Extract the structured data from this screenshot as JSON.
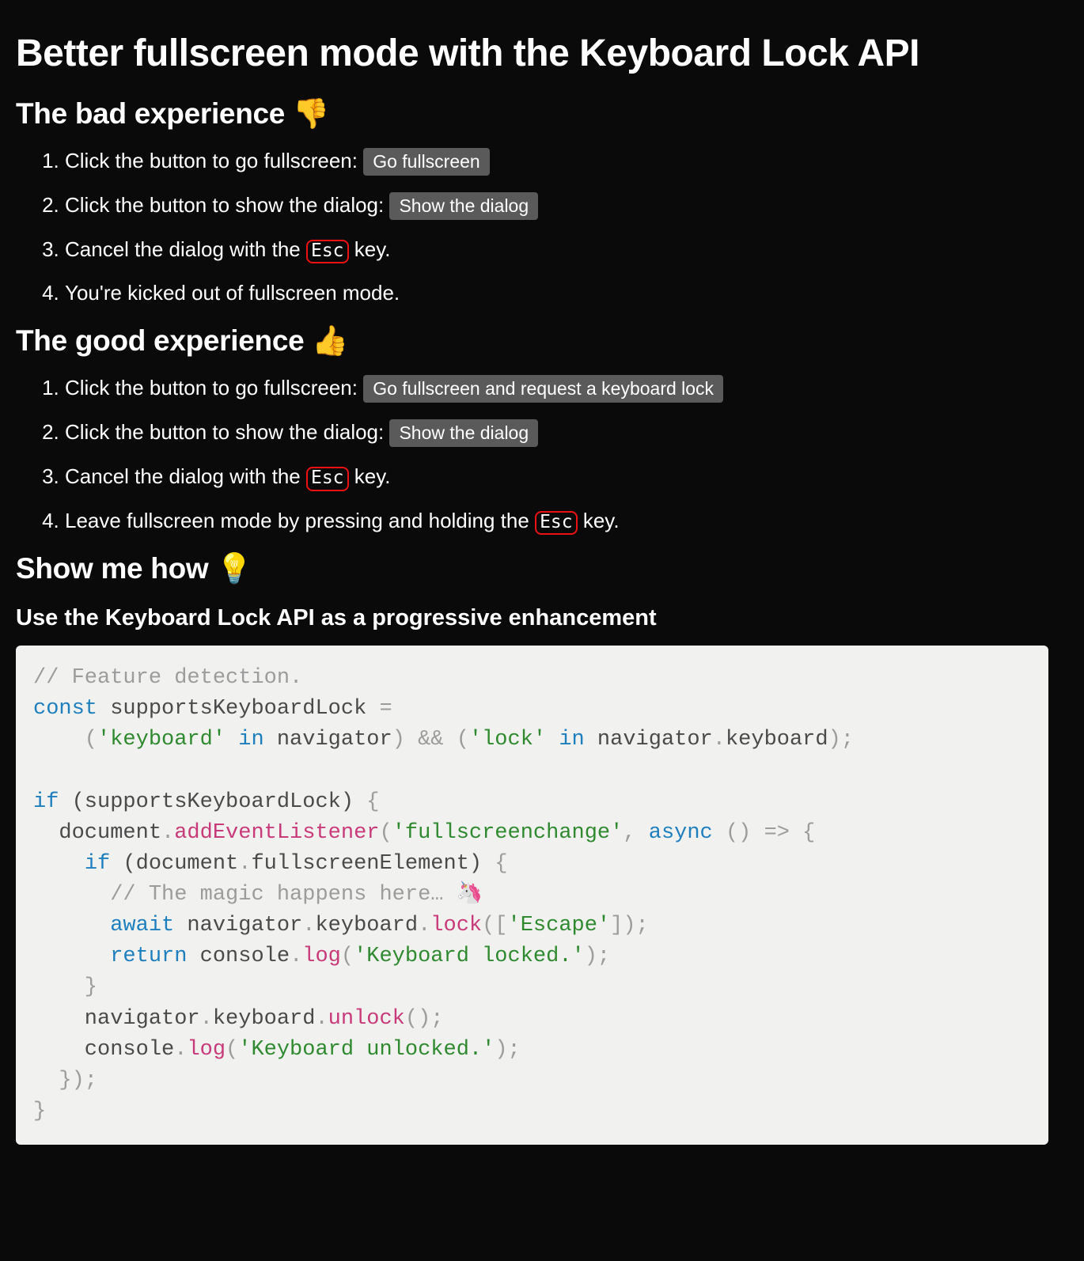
{
  "title": "Better fullscreen mode with the Keyboard Lock API",
  "bad": {
    "heading": "The bad experience 👎",
    "items": {
      "s1_pre": "Click the button to go fullscreen: ",
      "s1_btn": "Go fullscreen",
      "s2_pre": "Click the button to show the dialog: ",
      "s2_btn": "Show the dialog",
      "s3_pre": "Cancel the dialog with the ",
      "s3_kbd": "Esc",
      "s3_post": " key.",
      "s4": "You're kicked out of fullscreen mode."
    }
  },
  "good": {
    "heading": "The good experience 👍",
    "items": {
      "s1_pre": "Click the button to go fullscreen: ",
      "s1_btn": "Go fullscreen and request a keyboard lock",
      "s2_pre": "Click the button to show the dialog: ",
      "s2_btn": "Show the dialog",
      "s3_pre": "Cancel the dialog with the ",
      "s3_kbd": "Esc",
      "s3_post": " key.",
      "s4_pre": "Leave fullscreen mode by pressing and holding the ",
      "s4_kbd": "Esc",
      "s4_post": " key."
    }
  },
  "how": {
    "heading": "Show me how 💡",
    "subheading": "Use the Keyboard Lock API as a progressive enhancement"
  },
  "code": {
    "c1": "// Feature detection.",
    "c2a": "const",
    "c2b": " supportsKeyboardLock ",
    "c2c": "=",
    "c3a": "    (",
    "c3b": "'keyboard'",
    "c3c": " ",
    "c3d": "in",
    "c3e": " navigator",
    "c3f": ")",
    "c3g": " ",
    "c3h": "&&",
    "c3i": " (",
    "c3j": "'lock'",
    "c3k": " ",
    "c3l": "in",
    "c3m": " navigator",
    "c3n": ".",
    "c3o": "keyboard",
    "c3p": ");",
    "c5a": "if",
    "c5b": " (supportsKeyboardLock) ",
    "c5c": "{",
    "c6a": "  document",
    "c6b": ".",
    "c6c": "addEventListener",
    "c6d": "(",
    "c6e": "'fullscreenchange'",
    "c6f": ",",
    "c6g": " ",
    "c6h": "async",
    "c6i": " () ",
    "c6j": "=>",
    "c6k": " {",
    "c7a": "    ",
    "c7b": "if",
    "c7c": " (document",
    "c7d": ".",
    "c7e": "fullscreenElement) ",
    "c7f": "{",
    "c8": "      // The magic happens here… 🦄",
    "c9a": "      ",
    "c9b": "await",
    "c9c": " navigator",
    "c9d": ".",
    "c9e": "keyboard",
    "c9f": ".",
    "c9g": "lock",
    "c9h": "([",
    "c9i": "'Escape'",
    "c9j": "]);",
    "c10a": "      ",
    "c10b": "return",
    "c10c": " console",
    "c10d": ".",
    "c10e": "log",
    "c10f": "(",
    "c10g": "'Keyboard locked.'",
    "c10h": ");",
    "c11": "    }",
    "c12a": "    navigator",
    "c12b": ".",
    "c12c": "keyboard",
    "c12d": ".",
    "c12e": "unlock",
    "c12f": "();",
    "c13a": "    console",
    "c13b": ".",
    "c13c": "log",
    "c13d": "(",
    "c13e": "'Keyboard unlocked.'",
    "c13f": ");",
    "c14": "  });",
    "c15": "}"
  }
}
